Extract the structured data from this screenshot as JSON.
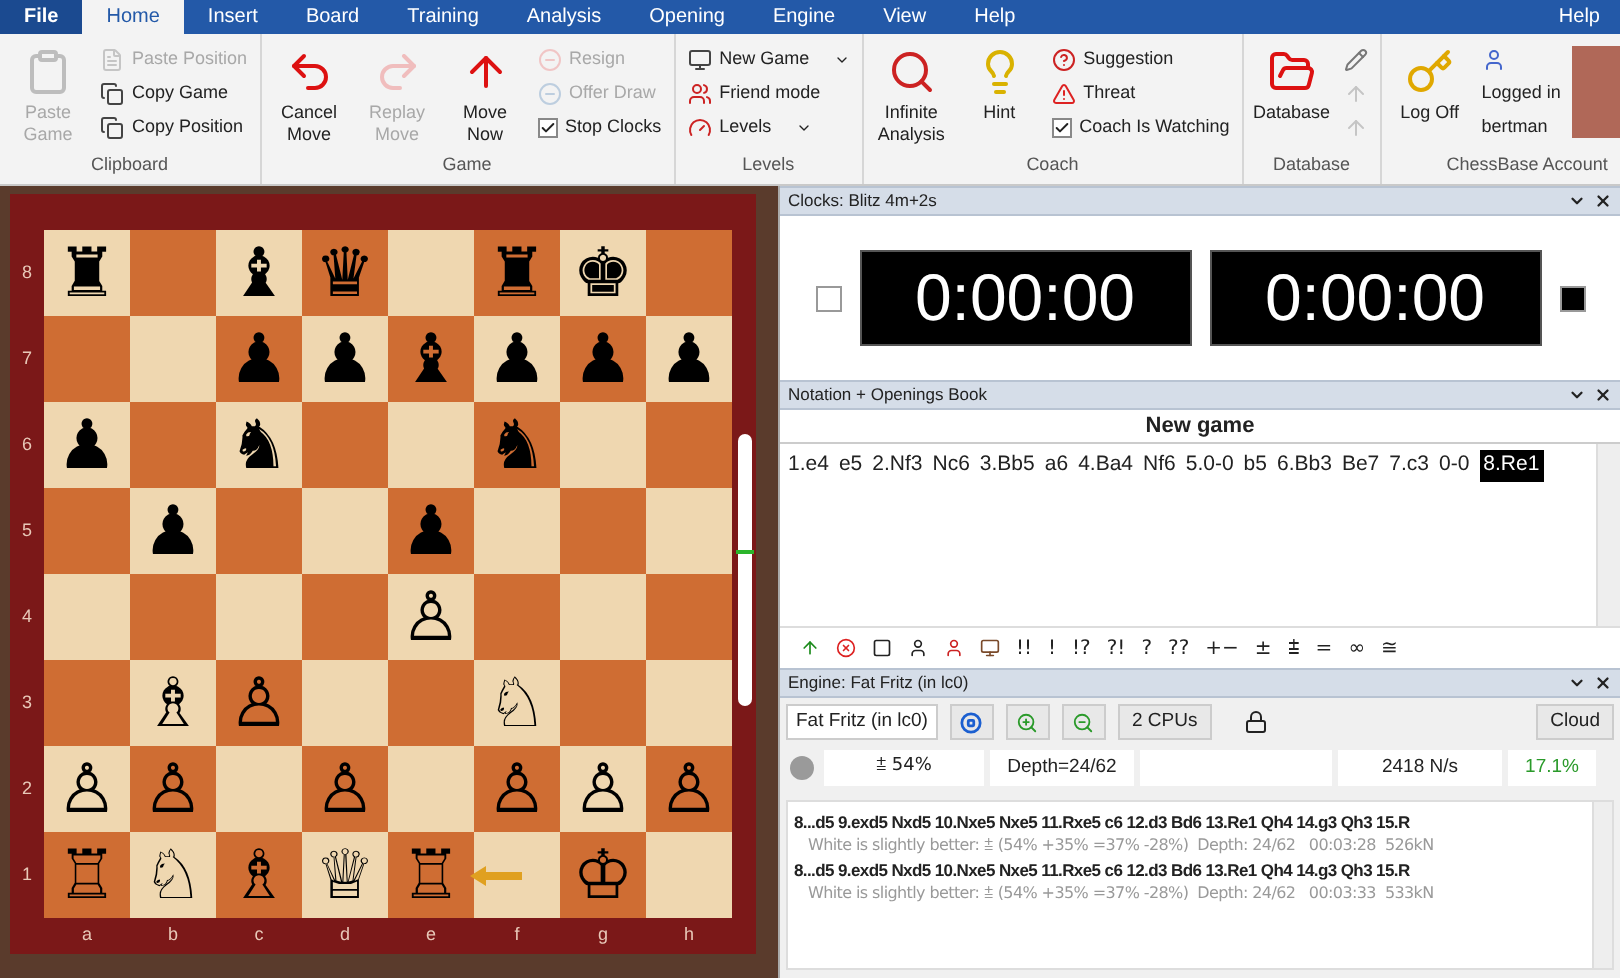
{
  "menu_tabs": [
    {
      "label": "File",
      "selected": false
    },
    {
      "label": "Home",
      "selected": true
    },
    {
      "label": "Insert",
      "selected": false
    },
    {
      "label": "Board",
      "selected": false
    },
    {
      "label": "Training",
      "selected": false
    },
    {
      "label": "Analysis",
      "selected": false
    },
    {
      "label": "Opening",
      "selected": false
    },
    {
      "label": "Engine",
      "selected": false
    },
    {
      "label": "View",
      "selected": false
    },
    {
      "label": "Help",
      "selected": false
    }
  ],
  "help_link": "Help",
  "ribbon_groups": [
    {
      "label": "Clipboard",
      "items": [
        {
          "kind": "large",
          "label": "Paste Game",
          "disabled": true
        },
        {
          "kind": "small",
          "label": "Paste Position",
          "disabled": true
        },
        {
          "kind": "small",
          "label": "Copy Game",
          "disabled": false
        },
        {
          "kind": "small",
          "label": "Copy Position",
          "disabled": false
        }
      ]
    },
    {
      "label": "Game",
      "items": [
        {
          "kind": "large",
          "label": "Cancel Move",
          "disabled": false
        },
        {
          "kind": "large",
          "label": "Replay Move",
          "disabled": true
        },
        {
          "kind": "large",
          "label": "Move Now",
          "disabled": false
        },
        {
          "kind": "small",
          "label": "Resign",
          "disabled": true
        },
        {
          "kind": "small",
          "label": "Offer Draw",
          "disabled": true
        },
        {
          "kind": "check",
          "label": "Stop Clocks",
          "checked": true
        }
      ]
    },
    {
      "label": "Levels",
      "items": [
        {
          "kind": "small",
          "label": "New Game",
          "disabled": false,
          "dropdown": true
        },
        {
          "kind": "small",
          "label": "Friend mode",
          "disabled": false
        },
        {
          "kind": "small",
          "label": "Levels",
          "disabled": false,
          "dropdown": true
        }
      ]
    },
    {
      "label": "Coach",
      "items": [
        {
          "kind": "large",
          "label": "Infinite Analysis",
          "disabled": false
        },
        {
          "kind": "large",
          "label": "Hint",
          "disabled": false
        },
        {
          "kind": "small",
          "label": "Suggestion",
          "disabled": false
        },
        {
          "kind": "small",
          "label": "Threat",
          "disabled": false
        },
        {
          "kind": "check",
          "label": "Coach Is Watching",
          "checked": true
        }
      ]
    },
    {
      "label": "Database",
      "items": [
        {
          "kind": "large",
          "label": "Database",
          "disabled": false
        },
        {
          "kind": "icon",
          "disabled": false
        },
        {
          "kind": "icon",
          "disabled": true
        },
        {
          "kind": "icon",
          "disabled": true
        }
      ]
    },
    {
      "label": "ChessBase Account",
      "items": [
        {
          "kind": "large",
          "label": "Log Off",
          "disabled": false
        },
        {
          "kind": "icon",
          "disabled": false
        },
        {
          "kind": "text",
          "label": "Logged in"
        },
        {
          "kind": "text",
          "label": "bertman"
        },
        {
          "kind": "photo"
        }
      ]
    }
  ],
  "board": {
    "files": [
      "a",
      "b",
      "c",
      "d",
      "e",
      "f",
      "g",
      "h"
    ],
    "ranks": [
      {
        "label": "8",
        "squares": [
          {
            "kind": "piece",
            "glyph": "♜"
          },
          {
            "kind": "empty"
          },
          {
            "kind": "piece",
            "glyph": "♝"
          },
          {
            "kind": "piece",
            "glyph": "♛"
          },
          {
            "kind": "empty"
          },
          {
            "kind": "piece",
            "glyph": "♜"
          },
          {
            "kind": "piece",
            "glyph": "♚"
          },
          {
            "kind": "empty"
          }
        ]
      },
      {
        "label": "7",
        "squares": [
          {
            "kind": "empty"
          },
          {
            "kind": "empty"
          },
          {
            "kind": "piece",
            "glyph": "♟"
          },
          {
            "kind": "piece",
            "glyph": "♟"
          },
          {
            "kind": "piece",
            "glyph": "♝"
          },
          {
            "kind": "piece",
            "glyph": "♟"
          },
          {
            "kind": "piece",
            "glyph": "♟"
          },
          {
            "kind": "piece",
            "glyph": "♟"
          }
        ]
      },
      {
        "label": "6",
        "squares": [
          {
            "kind": "piece",
            "glyph": "♟"
          },
          {
            "kind": "empty"
          },
          {
            "kind": "piece",
            "glyph": "♞"
          },
          {
            "kind": "empty"
          },
          {
            "kind": "empty"
          },
          {
            "kind": "piece",
            "glyph": "♞"
          },
          {
            "kind": "empty"
          },
          {
            "kind": "empty"
          }
        ]
      },
      {
        "label": "5",
        "squares": [
          {
            "kind": "empty"
          },
          {
            "kind": "piece",
            "glyph": "♟"
          },
          {
            "kind": "empty"
          },
          {
            "kind": "empty"
          },
          {
            "kind": "piece",
            "glyph": "♟"
          },
          {
            "kind": "empty"
          },
          {
            "kind": "empty"
          },
          {
            "kind": "empty"
          }
        ]
      },
      {
        "label": "4",
        "squares": [
          {
            "kind": "empty"
          },
          {
            "kind": "empty"
          },
          {
            "kind": "empty"
          },
          {
            "kind": "empty"
          },
          {
            "kind": "piece",
            "glyph": "♙"
          },
          {
            "kind": "empty"
          },
          {
            "kind": "empty"
          },
          {
            "kind": "empty"
          }
        ]
      },
      {
        "label": "3",
        "squares": [
          {
            "kind": "empty"
          },
          {
            "kind": "piece",
            "glyph": "♗"
          },
          {
            "kind": "piece",
            "glyph": "♙"
          },
          {
            "kind": "empty"
          },
          {
            "kind": "empty"
          },
          {
            "kind": "piece",
            "glyph": "♘"
          },
          {
            "kind": "empty"
          },
          {
            "kind": "empty"
          }
        ]
      },
      {
        "label": "2",
        "squares": [
          {
            "kind": "piece",
            "glyph": "♙"
          },
          {
            "kind": "piece",
            "glyph": "♙"
          },
          {
            "kind": "empty"
          },
          {
            "kind": "piece",
            "glyph": "♙"
          },
          {
            "kind": "empty"
          },
          {
            "kind": "piece",
            "glyph": "♙"
          },
          {
            "kind": "piece",
            "glyph": "♙"
          },
          {
            "kind": "piece",
            "glyph": "♙"
          }
        ]
      },
      {
        "label": "1",
        "squares": [
          {
            "kind": "piece",
            "glyph": "♖"
          },
          {
            "kind": "piece",
            "glyph": "♘"
          },
          {
            "kind": "piece",
            "glyph": "♗"
          },
          {
            "kind": "piece",
            "glyph": "♕"
          },
          {
            "kind": "piece",
            "glyph": "♖"
          },
          {
            "kind": "arrow_left"
          },
          {
            "kind": "piece",
            "glyph": "♔"
          },
          {
            "kind": "empty"
          }
        ]
      }
    ],
    "eval_bar": {
      "level": 0.56
    }
  },
  "clocks": {
    "title": "Clocks: Blitz 4m+2s",
    "players": [
      {
        "time": "0:00:00",
        "color": "#ffffff"
      },
      {
        "time": "0:00:00",
        "color": "#000000"
      }
    ]
  },
  "notation": {
    "title": "Notation + Openings Book",
    "heading": "New game",
    "moves": [
      {
        "text": "1.e4",
        "selected": false
      },
      {
        "text": "e5",
        "selected": false
      },
      {
        "text": "2.Nf3",
        "selected": false
      },
      {
        "text": "Nc6",
        "selected": false
      },
      {
        "text": "3.Bb5",
        "selected": false
      },
      {
        "text": "a6",
        "selected": false
      },
      {
        "text": "4.Ba4",
        "selected": false
      },
      {
        "text": "Nf6",
        "selected": false
      },
      {
        "text": "5.0-0",
        "selected": false
      },
      {
        "text": "b5",
        "selected": false
      },
      {
        "text": "6.Bb3",
        "selected": false
      },
      {
        "text": "Be7",
        "selected": false
      },
      {
        "text": "7.c3",
        "selected": false
      },
      {
        "text": "0-0",
        "selected": false
      },
      {
        "text": "8.Re1",
        "selected": true
      }
    ],
    "symbols": [
      "!!",
      "!",
      "!?",
      "?!",
      "?",
      "??",
      "+−",
      "±",
      "⩲",
      "=",
      "∞",
      "≅"
    ]
  },
  "engine": {
    "title": "Engine: Fat Fritz (in lc0)",
    "engine_button": "Fat Fritz (in lc0)",
    "cpus": "2 CPUs",
    "cloud": "Cloud",
    "eval": "⩲ 54%",
    "depth": "Depth=24/62",
    "speed": "2418 N/s",
    "load": "17.1%",
    "lines": [
      {
        "moves": "8...d5 9.exd5 Nxd5 10.Nxe5 Nxe5 11.Rxe5 c6 12.d3 Bd6 13.Re1 Qh4 14.g3 Qh3 15.R",
        "info": "White is slightly better: ⩲ (54% +35% =37% -28%)  Depth: 24/62   00:03:28  526kN"
      },
      {
        "moves": "8...d5 9.exd5 Nxd5 10.Nxe5 Nxe5 11.Rxe5 c6 12.d3 Bd6 13.Re1 Qh4 14.g3 Qh3 15.R",
        "info": "White is slightly better: ⩲ (54% +35% =37% -28%)  Depth: 24/62   00:03:33  533kN"
      }
    ]
  }
}
